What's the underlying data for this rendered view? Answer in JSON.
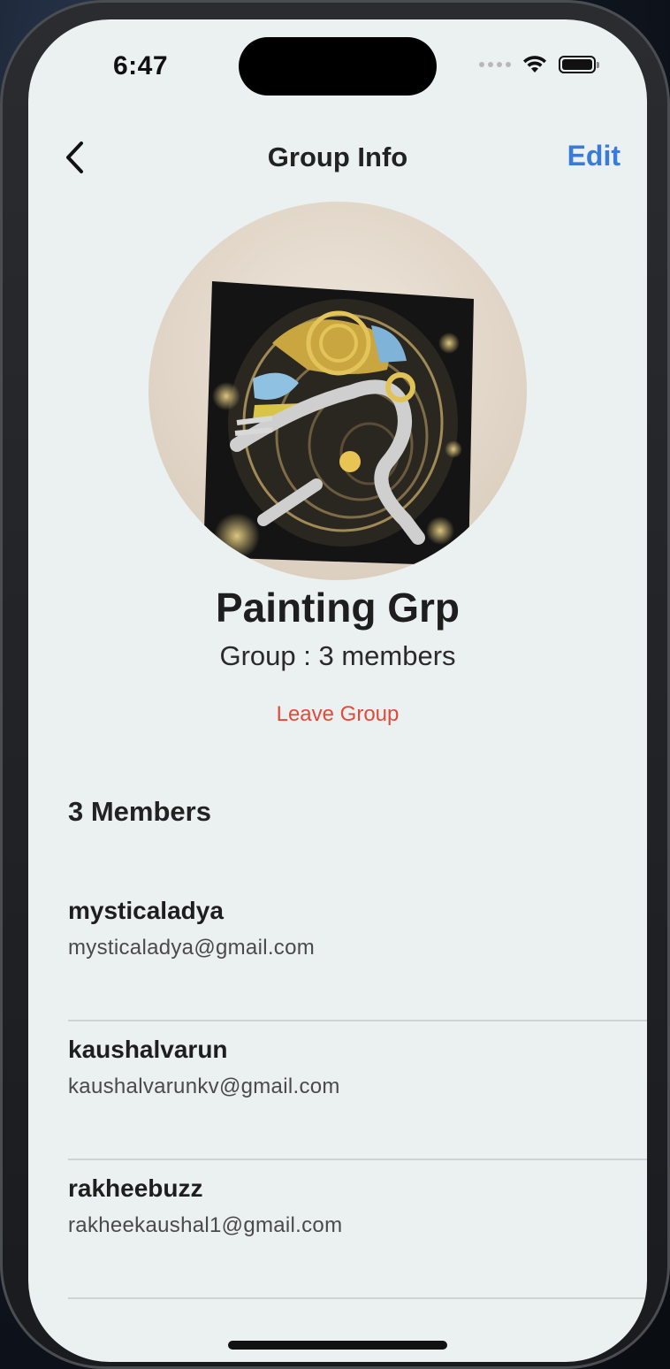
{
  "status_bar": {
    "time": "6:47"
  },
  "nav": {
    "title": "Group Info",
    "edit_label": "Edit"
  },
  "group": {
    "name": "Painting Grp",
    "subtitle": "Group : 3 members",
    "leave_label": "Leave Group"
  },
  "members": {
    "heading": "3 Members",
    "items": [
      {
        "username": "mysticaladya",
        "email": "mysticaladya@gmail.com"
      },
      {
        "username": "kaushalvarun",
        "email": "kaushalvarunkv@gmail.com"
      },
      {
        "username": "rakheebuzz",
        "email": "rakheekaushal1@gmail.com"
      }
    ]
  },
  "colors": {
    "accent": "#3a7bd5",
    "danger": "#e04b3c",
    "background": "#ebf0f0"
  },
  "icons": {
    "back": "chevron-left-icon",
    "wifi": "wifi-icon",
    "battery": "battery-icon",
    "signal": "signal-dots-icon"
  }
}
